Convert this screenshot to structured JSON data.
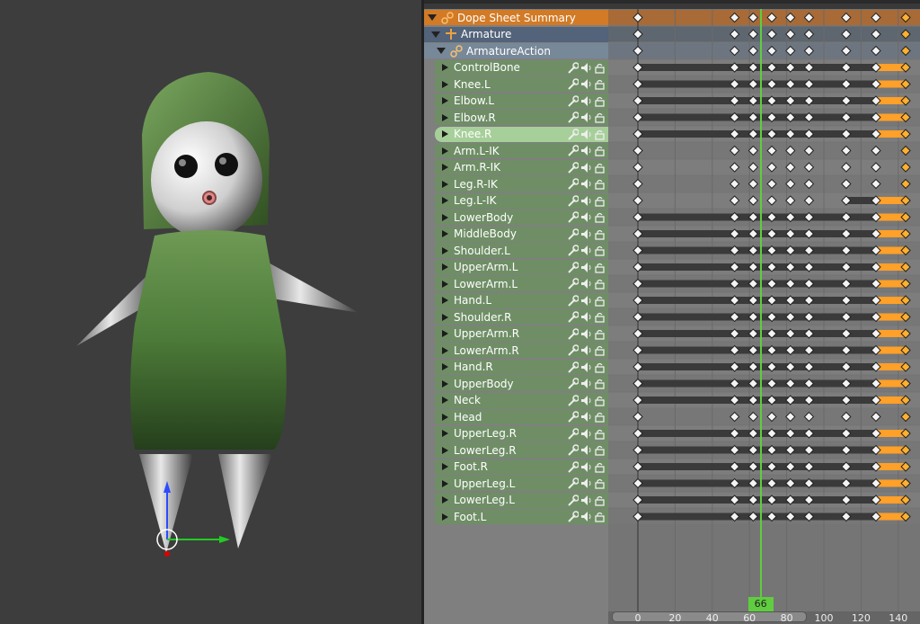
{
  "channels": {
    "summary": "Dope Sheet Summary",
    "object": "Armature",
    "action": "ArmatureAction",
    "groups": [
      "ControlBone",
      "Knee.L",
      "Elbow.L",
      "Elbow.R",
      "Knee.R",
      "Arm.L-IK",
      "Arm.R-IK",
      "Leg.R-IK",
      "Leg.L-IK",
      "LowerBody",
      "MiddleBody",
      "Shoulder.L",
      "UpperArm.L",
      "LowerArm.L",
      "Hand.L",
      "Shoulder.R",
      "UpperArm.R",
      "LowerArm.R",
      "Hand.R",
      "UpperBody",
      "Neck",
      "Head",
      "UpperLeg.R",
      "LowerLeg.R",
      "Foot.R",
      "UpperLeg.L",
      "LowerLeg.L",
      "Foot.L"
    ],
    "selected": "Knee.R"
  },
  "timeline": {
    "current_frame": 66,
    "current_frame_label": "66",
    "ticks": [
      "0",
      "20",
      "40",
      "60",
      "80",
      "100",
      "120",
      "140"
    ],
    "keyframes": [
      0,
      52,
      62,
      72,
      82,
      92,
      112,
      128,
      144
    ]
  },
  "colors": {
    "summary": "#d27a25",
    "frame_indicator": "#5fcd3f",
    "selected_key": "#ffa028"
  },
  "icons": [
    "wrench-icon",
    "speaker-icon",
    "lock-icon",
    "armature-icon",
    "action-icon"
  ]
}
